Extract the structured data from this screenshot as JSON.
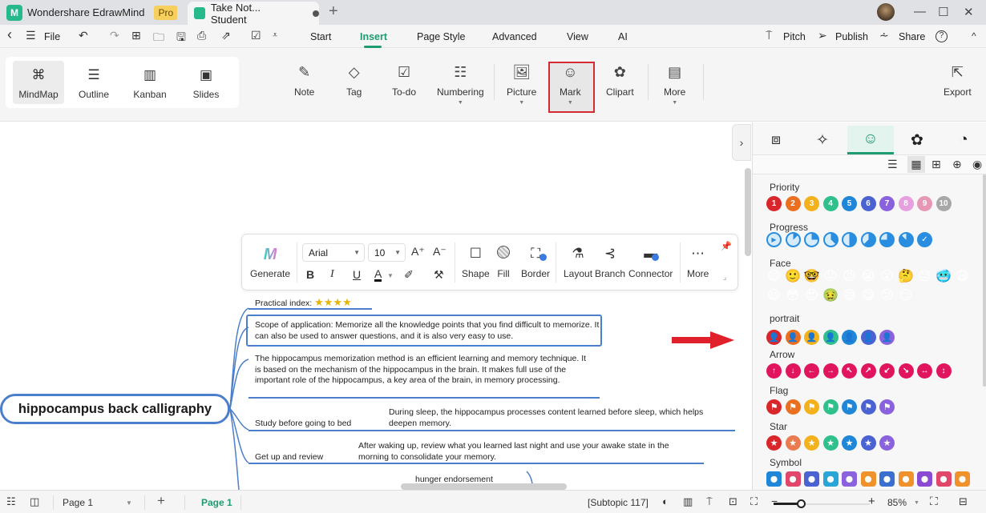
{
  "titlebar": {
    "app_name": "Wondershare EdrawMind",
    "pro_badge": "Pro",
    "doc_tab": "Take Not... Student",
    "new_tab": "+",
    "window_controls": {
      "minimize": "—",
      "maximize": "☐",
      "close": "✕"
    }
  },
  "menubar": {
    "back": "‹",
    "menu_icon": "☰",
    "file": "File",
    "undo": "↶",
    "redo": "↷",
    "tabs": [
      "Start",
      "Insert",
      "Page Style",
      "Advanced",
      "View",
      "AI"
    ],
    "active_tab": "Insert",
    "right": {
      "pitch": "Pitch",
      "publish": "Publish",
      "share": "Share",
      "help": "?",
      "collapse": "^"
    }
  },
  "ribbon": {
    "views": [
      "MindMap",
      "Outline",
      "Kanban",
      "Slides"
    ],
    "active_view": "MindMap",
    "insert_buttons": [
      {
        "label": "Note",
        "icon": "note-icon"
      },
      {
        "label": "Tag",
        "icon": "tag-icon"
      },
      {
        "label": "To-do",
        "icon": "todo-icon"
      },
      {
        "label": "Numbering",
        "icon": "numbering-icon",
        "dropdown": true
      },
      {
        "label": "Picture",
        "icon": "picture-icon",
        "dropdown": true
      },
      {
        "label": "Mark",
        "icon": "mark-icon",
        "dropdown": true,
        "highlighted": true
      },
      {
        "label": "Clipart",
        "icon": "clipart-icon"
      },
      {
        "label": "More",
        "icon": "more-icon",
        "dropdown": true
      }
    ],
    "export": "Export"
  },
  "floating_toolbar": {
    "generate": "Generate",
    "font": "Arial",
    "font_size": "10",
    "grow": "A⁺",
    "shrink": "A⁻",
    "bold": "B",
    "italic": "I",
    "underline": "U",
    "font_color": "A",
    "shape": "Shape",
    "fill": "Fill",
    "border": "Border",
    "layout": "Layout",
    "branch": "Branch",
    "connector": "Connector",
    "more": "More"
  },
  "mindmap": {
    "root": "hippocampus back calligraphy",
    "practical_index_label": "Practical index:",
    "practical_index_stars": 4,
    "scope": "Scope of application: Memorize all the knowledge points that you find difficult to memorize. It can also be used to answer questions, and it is also very easy to use.",
    "description": "The hippocampus memorization method is an efficient learning and memory technique. It is based on the mechanism of the hippocampus in the brain. It makes full use of the important role of the hippocampus, a key area of the brain, in memory processing.",
    "topics": [
      {
        "title": "Study before going to bed",
        "detail": "During sleep, the hippocampus processes content learned before sleep, which helps deepen memory."
      },
      {
        "title": "Get up and review",
        "detail": "After waking up, review what you learned last night and use your awake state in the morning to consolidate your memory."
      },
      {
        "title": "hunger endorsement",
        "detail": ""
      }
    ]
  },
  "panel": {
    "tabs": [
      "style-icon",
      "ai-icon",
      "mark-icon",
      "clipart-icon",
      "history-icon"
    ],
    "active_tab": "mark-icon",
    "categories": [
      {
        "name": "Priority",
        "items": [
          "1",
          "2",
          "3",
          "4",
          "5",
          "6",
          "7",
          "8",
          "9",
          "10"
        ],
        "colors": [
          "#d8262a",
          "#ea6f1f",
          "#f3b21b",
          "#2fc08b",
          "#1f86d8",
          "#4a62d2",
          "#8a62dd",
          "#e6a0e0",
          "#e597b4",
          "#a8a8a8"
        ]
      },
      {
        "name": "Progress",
        "items": [
          "0%",
          "12.5%",
          "25%",
          "37.5%",
          "50%",
          "62.5%",
          "75%",
          "87.5%",
          "100%"
        ]
      },
      {
        "name": "Face",
        "items": [
          "😄",
          "🙂",
          "🤓",
          "😟",
          "😡",
          "😭",
          "😮",
          "🤔",
          "😓",
          "🥶",
          "😷",
          "😆",
          "😳",
          "😍",
          "🤢",
          "😅",
          "😋",
          "😝",
          "😏"
        ]
      },
      {
        "name": "portrait",
        "colors": [
          "#d8262a",
          "#ea6f1f",
          "#f3b21b",
          "#2fc08b",
          "#1f86d8",
          "#4a62d2",
          "#8a62dd"
        ]
      },
      {
        "name": "Arrow",
        "items": [
          "↑",
          "↓",
          "←",
          "→",
          "↖",
          "↗",
          "↙",
          "↘",
          "↔",
          "↕"
        ],
        "color": "#e0155e"
      },
      {
        "name": "Flag",
        "colors": [
          "#d8262a",
          "#ea6f1f",
          "#f3b21b",
          "#2fc08b",
          "#1f86d8",
          "#4a62d2",
          "#8a62dd"
        ]
      },
      {
        "name": "Star",
        "colors": [
          "#d8262a",
          "#ea7a4f",
          "#f3b21b",
          "#2fc08b",
          "#1f86d8",
          "#4a62d2",
          "#8a62dd"
        ]
      },
      {
        "name": "Symbol",
        "colors": [
          "#1f86d8",
          "#e0476b",
          "#4a62d2",
          "#29a5d8",
          "#8a62dd",
          "#f0922b",
          "#3a6fd0",
          "#f0922b",
          "#8a4bd2",
          "#e0476b",
          "#f0922b"
        ]
      }
    ]
  },
  "statusbar": {
    "page_select": "Page 1",
    "add_page": "+",
    "active_page": "Page 1",
    "selection": "[Subtopic 117]",
    "zoom": "85%",
    "zoom_fraction": 0.28
  },
  "colors": {
    "accent": "#1f9b73",
    "branch": "#4b7fcb",
    "highlight": "#d42b33"
  }
}
